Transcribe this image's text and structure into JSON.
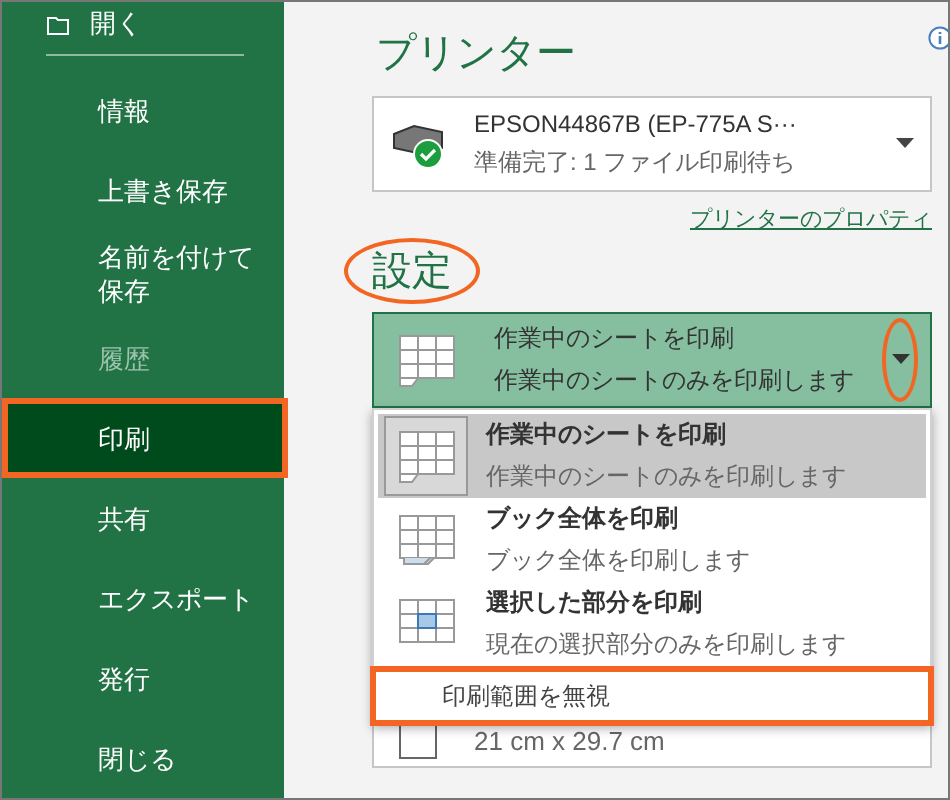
{
  "sidebar": {
    "back": {
      "label": "開く"
    },
    "items": [
      {
        "label": "情報",
        "selected": false,
        "disabled": false,
        "highlighted": false
      },
      {
        "label": "上書き保存",
        "selected": false,
        "disabled": false,
        "highlighted": false
      },
      {
        "label": "名前を付けて保存",
        "selected": false,
        "disabled": false,
        "highlighted": false
      },
      {
        "label": "履歴",
        "selected": false,
        "disabled": true,
        "highlighted": false
      },
      {
        "label": "印刷",
        "selected": true,
        "disabled": false,
        "highlighted": true
      },
      {
        "label": "共有",
        "selected": false,
        "disabled": false,
        "highlighted": false
      },
      {
        "label": "エクスポート",
        "selected": false,
        "disabled": false,
        "highlighted": false
      },
      {
        "label": "発行",
        "selected": false,
        "disabled": false,
        "highlighted": false
      },
      {
        "label": "閉じる",
        "selected": false,
        "disabled": false,
        "highlighted": false
      }
    ]
  },
  "printer": {
    "title": "プリンター",
    "name": "EPSON44867B (EP-775A S···",
    "status": "準備完了: 1 ファイル印刷待ち",
    "properties_link": "プリンターのプロパティ"
  },
  "settings": {
    "title": "設定",
    "title_highlighted": true,
    "print_what": {
      "title": "作業中のシートを印刷",
      "description": "作業中のシートのみを印刷します",
      "arrow_highlighted": true
    },
    "menu": [
      {
        "kind": "sheet",
        "title": "作業中のシートを印刷",
        "description": "作業中のシートのみを印刷します",
        "selected": true,
        "highlighted": false
      },
      {
        "kind": "book",
        "title": "ブック全体を印刷",
        "description": "ブック全体を印刷します",
        "selected": false,
        "highlighted": false
      },
      {
        "kind": "selection",
        "title": "選択した部分を印刷",
        "description": "現在の選択部分のみを印刷します",
        "selected": false,
        "highlighted": false
      },
      {
        "kind": "plain",
        "title": "印刷範囲を無視",
        "selected": false,
        "highlighted": true
      }
    ],
    "paper_size": "21 cm x 29.7 cm"
  }
}
